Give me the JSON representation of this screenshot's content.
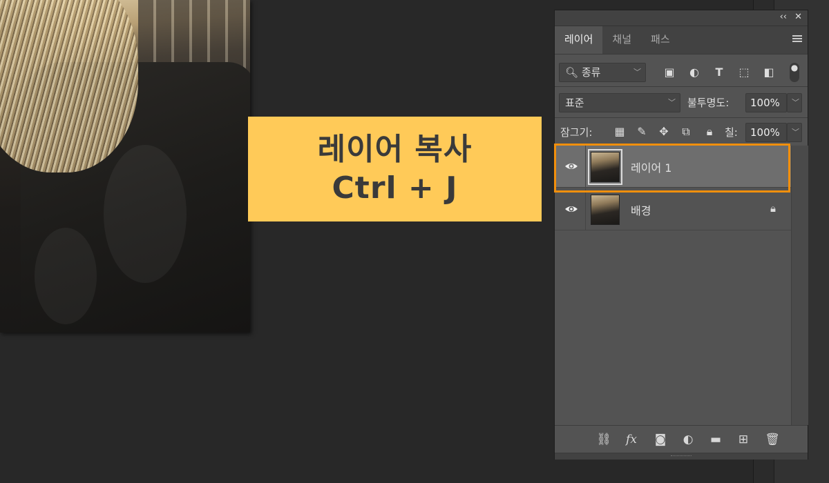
{
  "callout": {
    "line1": "레이어 복사",
    "line2": "Ctrl + J"
  },
  "panel": {
    "tabs": [
      {
        "label": "레이어"
      },
      {
        "label": "채널"
      },
      {
        "label": "패스"
      }
    ],
    "filter": {
      "label": "종류"
    },
    "blend_mode": "표준",
    "opacity_label": "불투명도:",
    "opacity_value": "100%",
    "lock_label": "잠그기:",
    "fill_label": "칠:",
    "fill_value": "100%",
    "layers": [
      {
        "name": "레이어 1",
        "selected": true,
        "locked": false
      },
      {
        "name": "배경",
        "selected": false,
        "locked": true
      }
    ],
    "footer_icons": [
      "link-icon",
      "fx-icon",
      "mask-icon",
      "adjustment-icon",
      "folder-icon",
      "new-layer-icon",
      "trash-icon"
    ]
  },
  "colors": {
    "callout_bg": "#ffca58",
    "highlight": "#f28f0c",
    "panel_bg": "#535353"
  }
}
